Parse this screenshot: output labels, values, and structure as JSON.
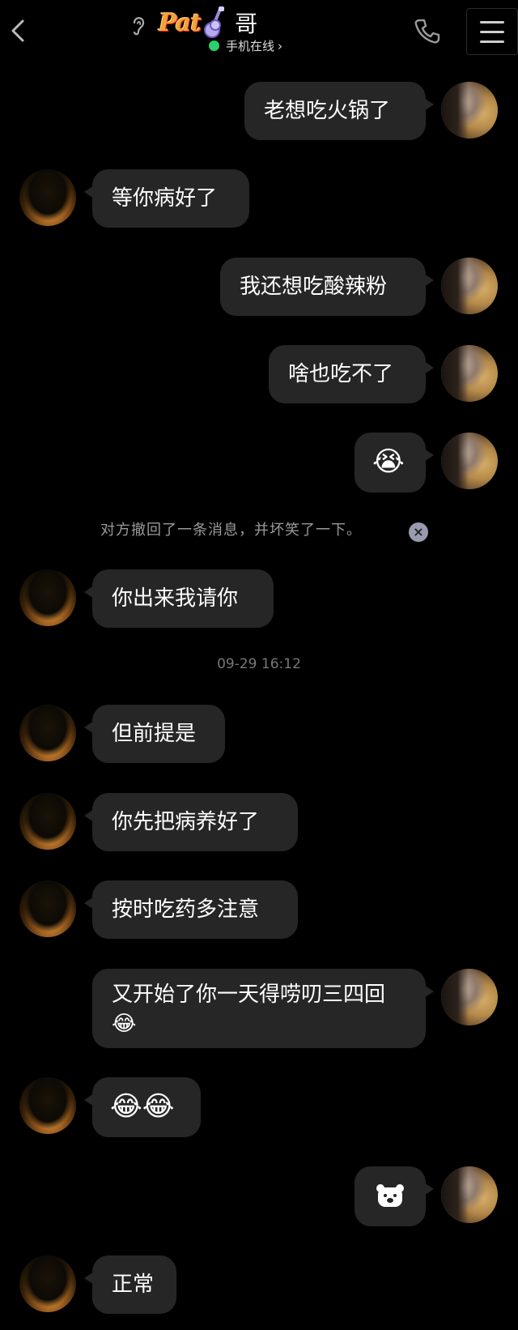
{
  "header": {
    "name_badge": "Pat",
    "name_suffix": "哥",
    "status": "手机在线",
    "status_chevron": "›",
    "icons": [
      "back-icon",
      "ear-icon",
      "guitar-icon",
      "phone-icon",
      "menu-icon"
    ]
  },
  "messages": [
    {
      "side": "right",
      "text": "老想吃火锅了"
    },
    {
      "side": "left",
      "text": "等你病好了"
    },
    {
      "side": "right",
      "text": "我还想吃酸辣粉"
    },
    {
      "side": "right",
      "text": "啥也吃不了"
    },
    {
      "side": "right",
      "text": "😭"
    },
    {
      "side": "left",
      "text": "你出来我请你"
    },
    {
      "side": "left",
      "text": "但前提是"
    },
    {
      "side": "left",
      "text": "你先把病养好了"
    },
    {
      "side": "left",
      "text": "按时吃药多注意"
    },
    {
      "side": "right",
      "text": "又开始了你一天得唠叨三四回😂"
    },
    {
      "side": "left",
      "text": "😂😂"
    },
    {
      "side": "right",
      "text": "",
      "sticker": "bear-icon"
    },
    {
      "side": "left",
      "text": "正常"
    }
  ],
  "system_notice": "对方撤回了一条消息，并坏笑了一下。",
  "system_close": "×",
  "timestamp": "09-29 16:12",
  "colors": {
    "background": "#000000",
    "bubble": "#262626",
    "online": "#2bd06a"
  }
}
